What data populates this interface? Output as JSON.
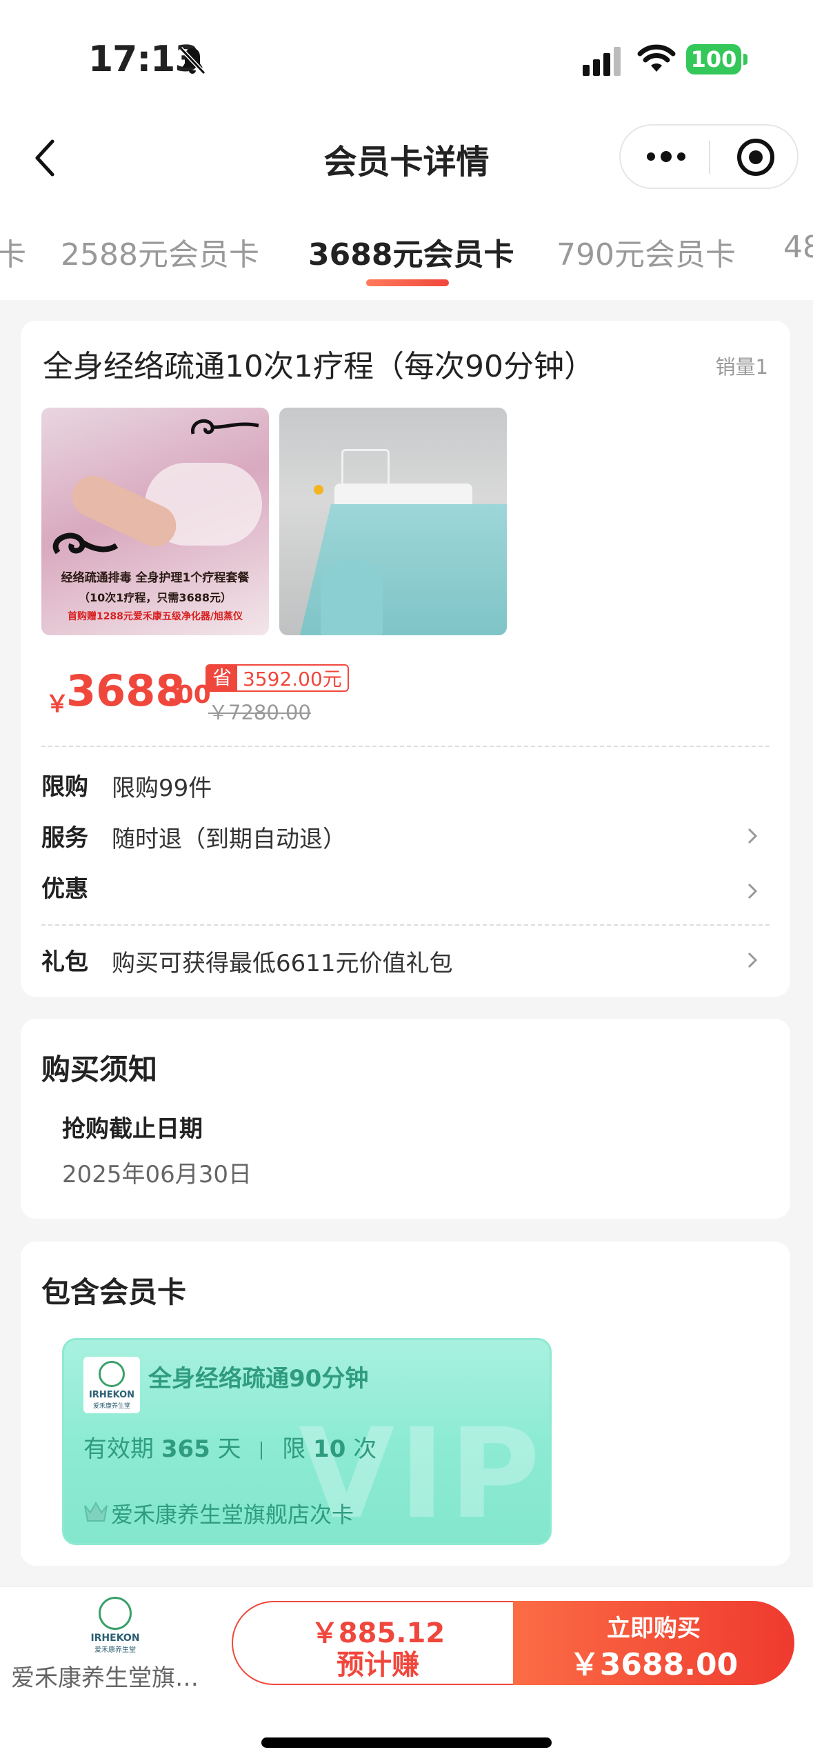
{
  "status_bar": {
    "time": "17:13",
    "battery": "100"
  },
  "nav": {
    "title": "会员卡详情"
  },
  "tabs": [
    {
      "label": "卡"
    },
    {
      "label": "2588元会员卡"
    },
    {
      "label": "3688元会员卡",
      "active": true
    },
    {
      "label": "790元会员卡"
    },
    {
      "label": "48"
    }
  ],
  "product": {
    "title": "全身经络疏通10次1疗程（每次90分钟）",
    "sales": "销量1",
    "image1_caption": "经络疏通排毒 全身护理1个疗程套餐",
    "image1_sub": "（10次1疗程，只需3688元）",
    "image1_gift": "首购赠1288元爱禾康五级净化器/旭蒸仪",
    "price_symbol": "￥",
    "price_int": "3688",
    "price_dec": ".00",
    "save_tag": "省",
    "save_amount": "3592.00元",
    "original_price": "￥7280.00"
  },
  "details": [
    {
      "label": "限购",
      "value": "限购99件"
    },
    {
      "label": "服务",
      "value": "随时退（到期自动退）"
    },
    {
      "label": "优惠",
      "value": ""
    },
    {
      "label": "礼包",
      "value": "购买可获得最低6611元价值礼包"
    }
  ],
  "notice": {
    "heading": "购买须知",
    "subheading": "抢购截止日期",
    "date": "2025年06月30日"
  },
  "included": {
    "heading": "包含会员卡",
    "card_title": "全身经络疏通90分钟",
    "logo_text": "IRHEKON",
    "logo_sub": "爱禾康养生堂",
    "validity_prefix": "有效期",
    "validity_days": "365",
    "validity_unit": "天",
    "limit_prefix": "限",
    "limit_count": "10",
    "limit_unit": "次",
    "watermark": "VIP",
    "store": "爱禾康养生堂旗舰店次卡"
  },
  "bottom": {
    "store_name": "爱禾康养生堂旗…",
    "logo_text": "IRHEKON",
    "logo_sub": "爱禾康养生堂",
    "earn_amount": "￥885.12",
    "earn_label": "预计赚",
    "buy_label": "立即购买",
    "buy_price": "￥3688.00"
  },
  "colors": {
    "accent": "#f0473d",
    "teal": "#2f9c80",
    "battery": "#34c759"
  }
}
